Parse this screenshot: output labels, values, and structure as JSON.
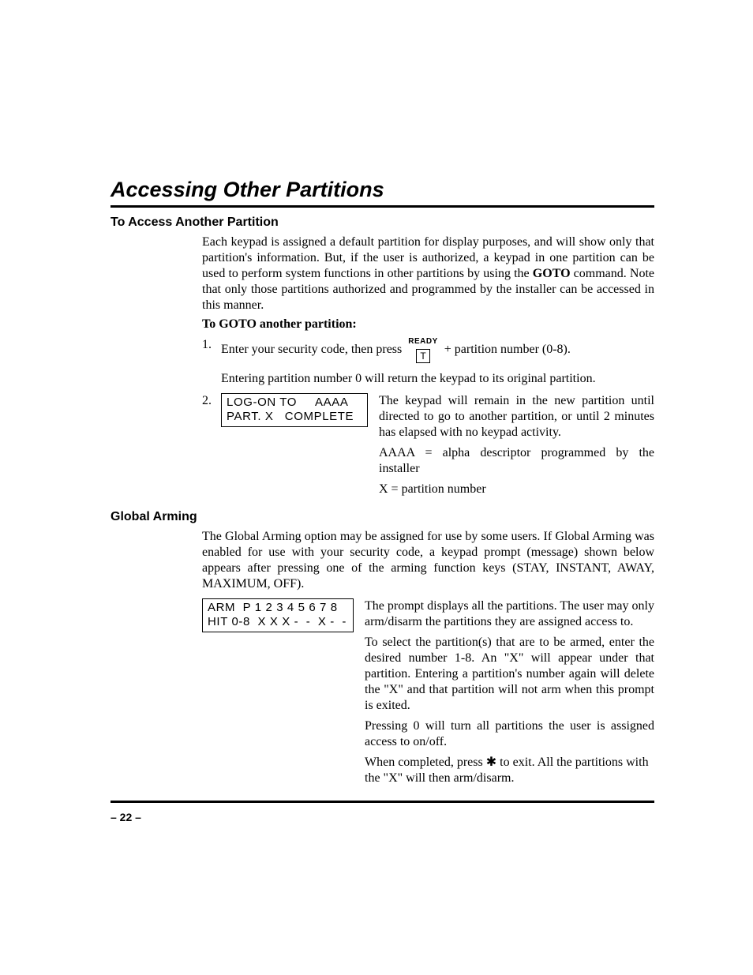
{
  "title": "Accessing Other Partitions",
  "section1": {
    "heading": "To Access Another Partition",
    "intro_pre": "Each keypad is assigned a default partition for display purposes, and will show only that partition's information. But, if the user is authorized, a keypad in one partition can be used to perform system functions in other partitions by using the ",
    "intro_bold": "GOTO",
    "intro_post": " command. Note that only those partitions authorized and programmed by the installer can be accessed in this manner.",
    "subhead": "To GOTO another partition:",
    "step1_num": "1.",
    "step1_a": "Enter your security code, then press",
    "ready": "READY",
    "key": "T",
    "step1_b": "+ partition number (0-8).",
    "step1_note": "Entering partition number 0 will return the keypad to its original partition.",
    "step2_num": "2.",
    "lcd_line1": "LOG-ON TO     AAAA",
    "lcd_line2": "PART. X   COMPLETE",
    "step2_p1": "The keypad will remain in the new partition until directed to go to another partition, or until 2 minutes has elapsed with no keypad activity.",
    "step2_p2": "AAAA = alpha descriptor programmed by the installer",
    "step2_p3": "X = partition number"
  },
  "section2": {
    "heading": "Global Arming",
    "intro": "The Global Arming option may be assigned for use by some users. If Global Arming was enabled for use with your security code, a keypad prompt (message) shown below appears after pressing one of the arming function keys (STAY, INSTANT, AWAY, MAXIMUM, OFF).",
    "lcd_line1": "ARM  P 1 2 3 4 5 6 7 8",
    "lcd_line2": "HIT 0-8  X X X -  -  X -  -",
    "p1": "The prompt displays all the partitions. The user may only arm/disarm the partitions they are assigned access to.",
    "p2": "To select the partition(s) that are to be armed, enter the desired number 1-8. An \"X\" will appear under that partition. Entering a partition's number again will delete the \"X\" and that partition will not arm when this prompt is exited.",
    "p3": "Pressing 0 will turn all partitions the user is assigned access to on/off.",
    "p4a": "When completed, press ",
    "p4_star": "✱",
    "p4b": " to exit. All the partitions with the \"X\" will then arm/disarm."
  },
  "page_number": "– 22 –"
}
